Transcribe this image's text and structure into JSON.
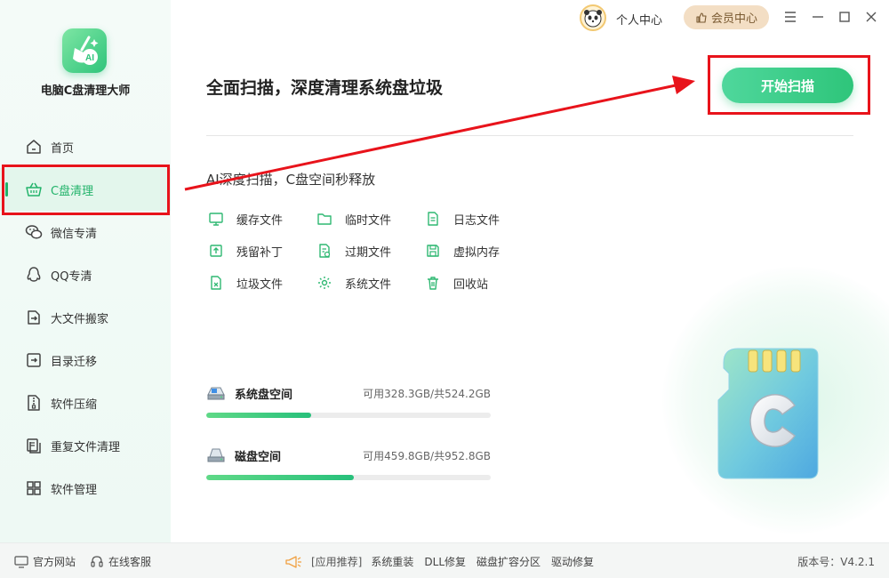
{
  "app": {
    "title": "电脑C盘清理大师"
  },
  "sidebar": {
    "items": [
      {
        "label": "首页",
        "icon": "home-icon"
      },
      {
        "label": "C盘清理",
        "icon": "basket-icon"
      },
      {
        "label": "微信专清",
        "icon": "wechat-icon"
      },
      {
        "label": "QQ专清",
        "icon": "qq-icon"
      },
      {
        "label": "大文件搬家",
        "icon": "move-file-icon"
      },
      {
        "label": "目录迁移",
        "icon": "migrate-icon"
      },
      {
        "label": "软件压缩",
        "icon": "zip-icon"
      },
      {
        "label": "重复文件清理",
        "icon": "duplicate-icon"
      },
      {
        "label": "软件管理",
        "icon": "apps-icon"
      }
    ],
    "active": "C盘清理"
  },
  "topbar": {
    "user_center": "个人中心",
    "vip_center": "会员中心"
  },
  "main": {
    "headline": "全面扫描，深度清理系统盘垃圾",
    "scan_button": "开始扫描",
    "sub_headline": "AI深度扫描，C盘空间秒释放",
    "features": [
      {
        "label": "缓存文件",
        "icon": "monitor-icon"
      },
      {
        "label": "临时文件",
        "icon": "folder-icon"
      },
      {
        "label": "日志文件",
        "icon": "log-file-icon"
      },
      {
        "label": "残留补丁",
        "icon": "patch-icon"
      },
      {
        "label": "过期文件",
        "icon": "expired-file-icon"
      },
      {
        "label": "虚拟内存",
        "icon": "memory-icon"
      },
      {
        "label": "垃圾文件",
        "icon": "junk-file-icon"
      },
      {
        "label": "系统文件",
        "icon": "gear-icon"
      },
      {
        "label": "回收站",
        "icon": "trash-icon"
      }
    ],
    "disks": [
      {
        "name": "系统盘空间",
        "usage": "可用328.3GB/共524.2GB",
        "used_fraction": 0.37
      },
      {
        "name": "磁盘空间",
        "usage": "可用459.8GB/共952.8GB",
        "used_fraction": 0.52
      }
    ]
  },
  "footer": {
    "official_site": "官方网站",
    "online_service": "在线客服",
    "recommend": "[应用推荐]",
    "links": [
      "系统重装",
      "DLL修复",
      "磁盘扩容分区",
      "驱动修复"
    ],
    "version": "版本号：V4.2.1"
  },
  "colors": {
    "accent": "#22b36a",
    "highlight_red": "#e8131b",
    "vip_bg": "#f3dec4"
  }
}
